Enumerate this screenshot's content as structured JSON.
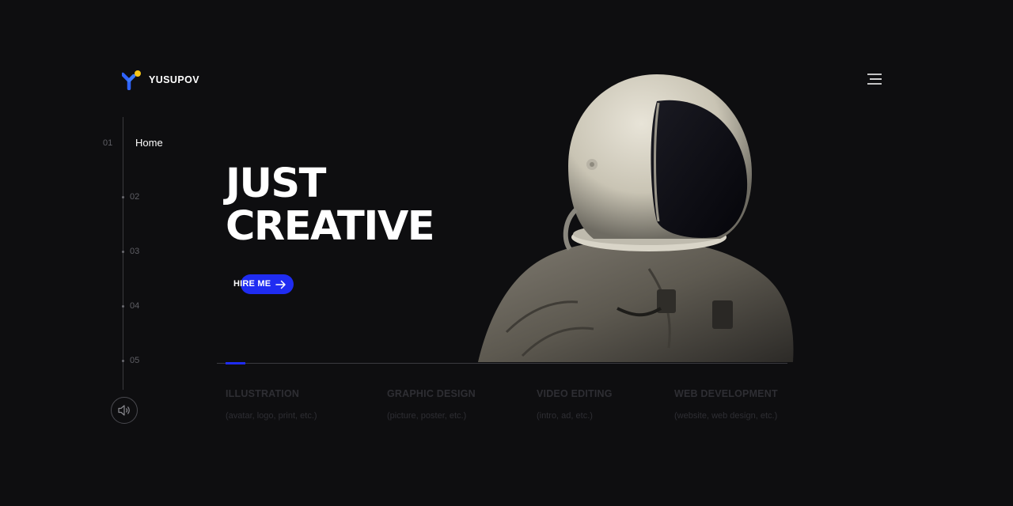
{
  "brand": {
    "name": "YUSUPOV",
    "accent": "#1f2cf2",
    "logo_yellow": "#f5c518",
    "logo_blue": "#2f63ff"
  },
  "header": {
    "menu_icon": "hamburger-menu-icon"
  },
  "nav": {
    "active": {
      "number": "01",
      "label": "Home"
    },
    "items": [
      "02",
      "03",
      "04",
      "05"
    ]
  },
  "sound": {
    "icon": "speaker-icon"
  },
  "hero": {
    "line1": "JUST",
    "line2": "CREATIVE",
    "cta_label": "HIRE ME",
    "cta_icon": "arrow-right-icon",
    "image": "astronaut-image"
  },
  "progress": {
    "value": 0.034
  },
  "services": [
    {
      "title": "ILLUSTRATION",
      "subtitle": "(avatar, logo, print, etc.)"
    },
    {
      "title": "GRAPHIC DESIGN",
      "subtitle": "(picture, poster, etc.)"
    },
    {
      "title": "VIDEO EDITING",
      "subtitle": "(intro, ad, etc.)"
    },
    {
      "title": "WEB DEVELOPMENT",
      "subtitle": "(website, web design, etc.)"
    }
  ]
}
